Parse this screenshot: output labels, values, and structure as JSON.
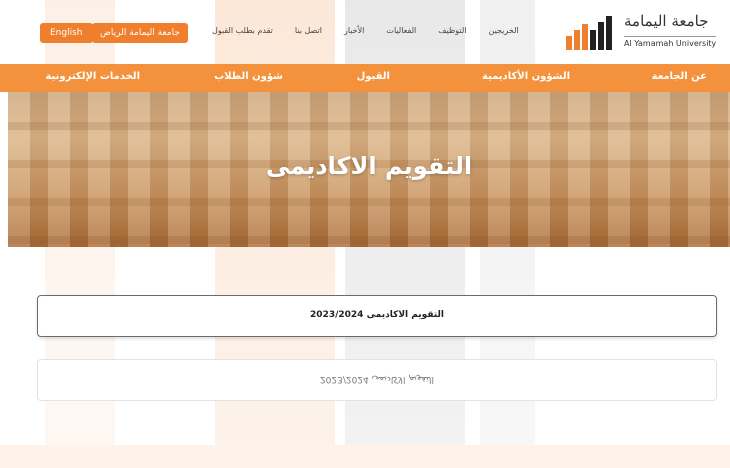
{
  "colors": {
    "accent": "#f07f2d",
    "nav": "#f3913c",
    "logo_orange": "#f07f2d",
    "logo_dark": "#222222"
  },
  "header": {
    "english_label": "English",
    "city_label": "جامعة اليمامة الرياض",
    "links": [
      "الخريجين",
      "التوظيف",
      "الفعاليات",
      "الأخبار",
      "اتصل بنا",
      "تقدم بطلب القبول"
    ]
  },
  "logo": {
    "arabic": "جامعة اليمامة",
    "english": "Al Yamamah University",
    "icon": "bars-logo-icon"
  },
  "nav": {
    "items": [
      "عن الجامعة",
      "الشؤون الأكاديمية",
      "القبول",
      "شؤون الطلاب",
      "الخدمات الإلكترونية"
    ]
  },
  "hero": {
    "title": "التقويم الاكاديمى"
  },
  "panels": [
    {
      "label": "التقويم الاكاديمى 2023/2024"
    },
    {
      "label": "التقويم الاكاديمى 2023/2024"
    }
  ]
}
